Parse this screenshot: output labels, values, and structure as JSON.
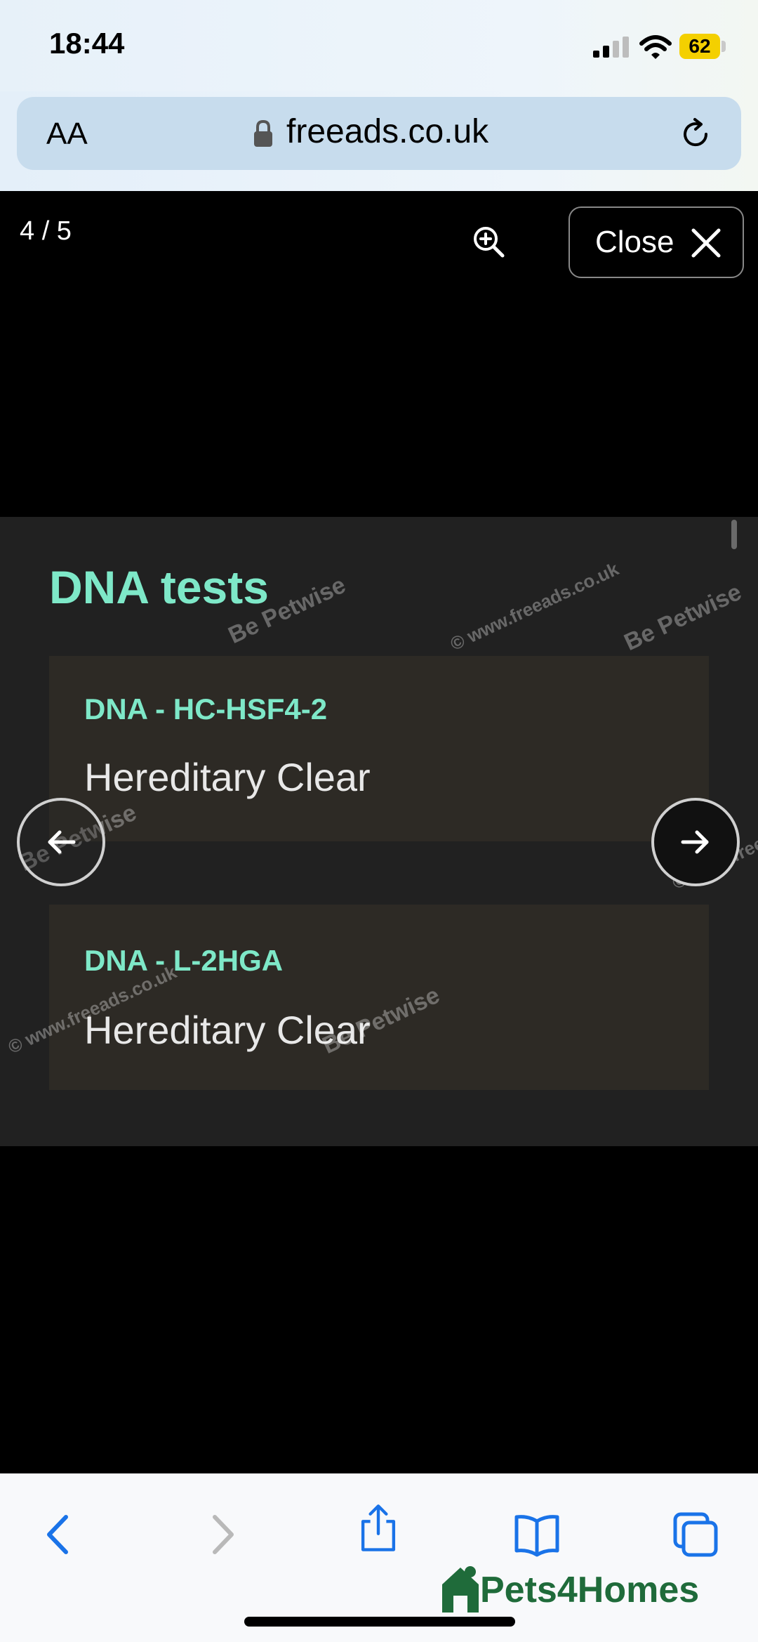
{
  "status_bar": {
    "time": "18:44",
    "battery": "62"
  },
  "browser": {
    "text_size_label": "AA",
    "url": "freeads.co.uk"
  },
  "viewer": {
    "counter": "4 / 5",
    "close_label": "Close",
    "image": {
      "title": "DNA tests",
      "tests": [
        {
          "name": "DNA - HC-HSF4-2",
          "result": "Hereditary Clear"
        },
        {
          "name": "DNA - L-2HGA",
          "result": "Hereditary Clear"
        }
      ],
      "watermark_site": "© www.freeads.co.uk",
      "watermark_brand": "Be Petwise"
    }
  },
  "toolbar": {
    "brand": "Pets4Homes"
  },
  "colors": {
    "accent": "#7ee8c8",
    "ios_blue": "#1a73e8",
    "brand_green": "#1f6b3a",
    "battery": "#f4d000"
  },
  "icons": [
    "signal-icon",
    "wifi-icon",
    "battery-icon",
    "lock-icon",
    "reload-icon",
    "zoom-in-icon",
    "close-icon",
    "arrow-left-icon",
    "arrow-right-icon",
    "back-icon",
    "forward-icon",
    "share-icon",
    "bookmarks-icon",
    "tabs-icon"
  ]
}
